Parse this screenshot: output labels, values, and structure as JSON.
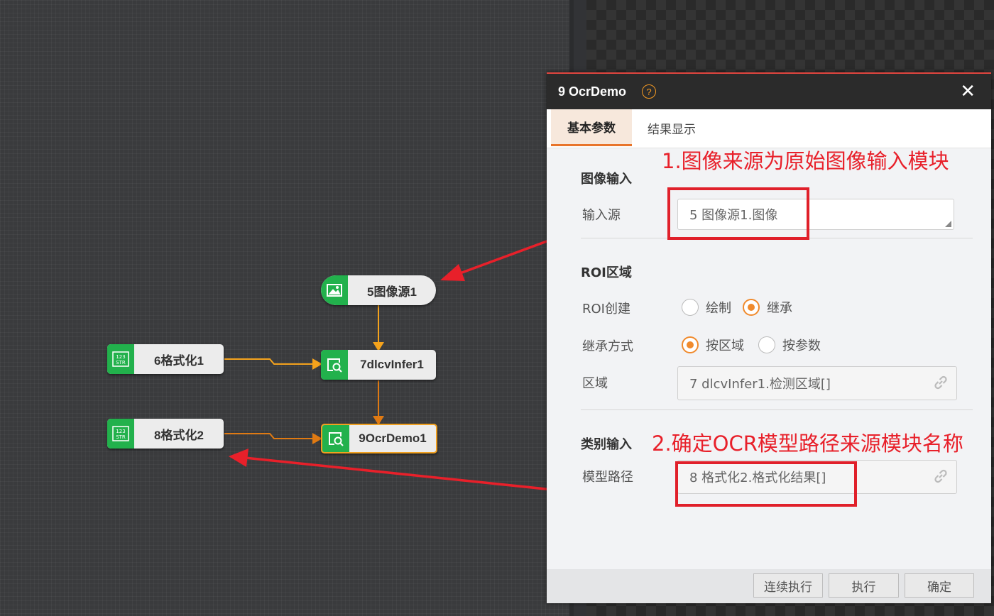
{
  "flow": {
    "nodes": [
      {
        "label": "5图像源1",
        "icon": "image-icon"
      },
      {
        "label": "6格式化1",
        "icon": "str-format-icon"
      },
      {
        "label": "7dlcvInfer1",
        "icon": "search-module-icon"
      },
      {
        "label": "8格式化2",
        "icon": "str-format-icon"
      },
      {
        "label": "9OcrDemo1",
        "icon": "search-module-icon"
      }
    ],
    "icon_text": {
      "top": "123",
      "bottom": "STR"
    }
  },
  "dialog": {
    "title": "9 OcrDemo",
    "help": "?",
    "close": "✕",
    "tabs": [
      "基本参数",
      "结果显示"
    ],
    "image_input": {
      "section": "图像输入",
      "source_label": "输入源",
      "source_value": "5 图像源1.图像"
    },
    "roi": {
      "section": "ROI区域",
      "create_label": "ROI创建",
      "create_options": [
        "绘制",
        "继承"
      ],
      "create_selected": "继承",
      "inherit_label": "继承方式",
      "inherit_options": [
        "按区域",
        "按参数"
      ],
      "inherit_selected": "按区域",
      "region_label": "区域",
      "region_value": "7 dlcvInfer1.检测区域[]"
    },
    "category": {
      "section": "类别输入",
      "model_label": "模型路径",
      "model_value": "8 格式化2.格式化结果[]"
    },
    "buttons": {
      "continuous": "连续执行",
      "run": "执行",
      "ok": "确定"
    }
  },
  "annotations": {
    "note1": "1.图像来源为原始图像输入模块",
    "note2": "2.确定OCR模型路径来源模块名称"
  },
  "colors": {
    "accent": "#f08a2c",
    "node_green": "#22b14c",
    "annotation_red": "#e8202a"
  }
}
